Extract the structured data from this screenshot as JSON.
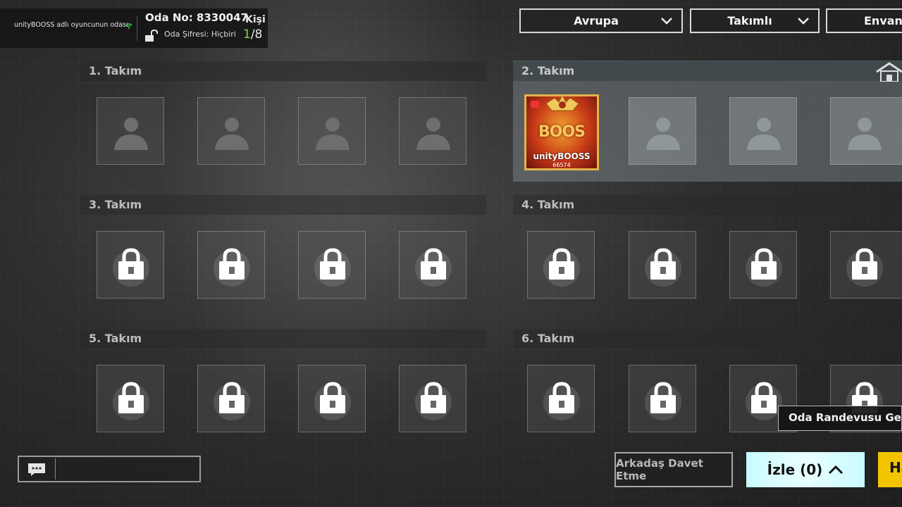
{
  "room": {
    "host_label": "unityBOOSS adlı oyuncunun odası",
    "room_no": "Oda No: 8330047",
    "password": "Oda Şifresi: Hiçbiri",
    "players_label": "Kişi",
    "players_current": "1",
    "players_total": "/8"
  },
  "top_bar": {
    "region": "Avrupa",
    "mode": "Takımlı",
    "inventory": "Envanter"
  },
  "teams": [
    {
      "label": "1. Takım"
    },
    {
      "label": "2. Takım"
    },
    {
      "label": "3. Takım"
    },
    {
      "label": "4. Takım"
    },
    {
      "label": "5. Takım"
    },
    {
      "label": "6. Takım"
    }
  ],
  "player": {
    "name": "unityBOOSS",
    "id": "66574",
    "banner_text": "BOOS"
  },
  "bottom": {
    "invite": "Arkadaş Davet Etme",
    "watch": "İzle (0)",
    "ready": "Hazır",
    "tooltip": "Oda Randevusu Geri"
  },
  "colors": {
    "accent_cyan": "#c9fbff",
    "ready_yellow": "#f2c500",
    "player_count_green": "#7ed957",
    "player_frame_gold": "#e2b54a"
  }
}
